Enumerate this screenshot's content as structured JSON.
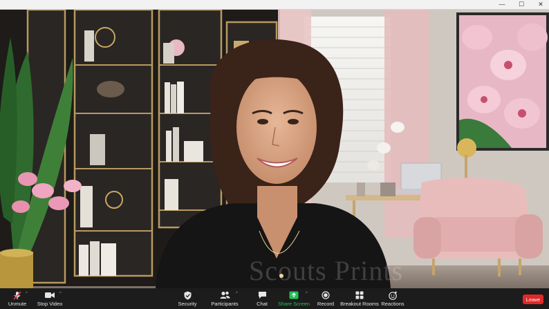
{
  "window": {
    "minimize_glyph": "—",
    "maximize_glyph": "☐",
    "close_glyph": "✕"
  },
  "video": {
    "watermark": "Scouts Prints"
  },
  "toolbar": {
    "unmute": "Unmute",
    "stop_video": "Stop Video",
    "security": "Security",
    "participants": "Participants",
    "chat": "Chat",
    "share_screen": "Share Screen",
    "record": "Record",
    "breakout_rooms": "Breakout Rooms",
    "reactions": "Reactions",
    "leave": "Leave",
    "chevron": "^"
  },
  "colors": {
    "toolbar_bg": "#1c1c1c",
    "share_green": "#25c057",
    "leave_red": "#e02828",
    "muted_red": "#e5484d"
  },
  "icons": [
    "microphone-muted-icon",
    "video-camera-icon",
    "shield-icon",
    "participants-icon",
    "chat-bubble-icon",
    "share-screen-icon",
    "record-icon",
    "breakout-rooms-icon",
    "reactions-icon"
  ]
}
